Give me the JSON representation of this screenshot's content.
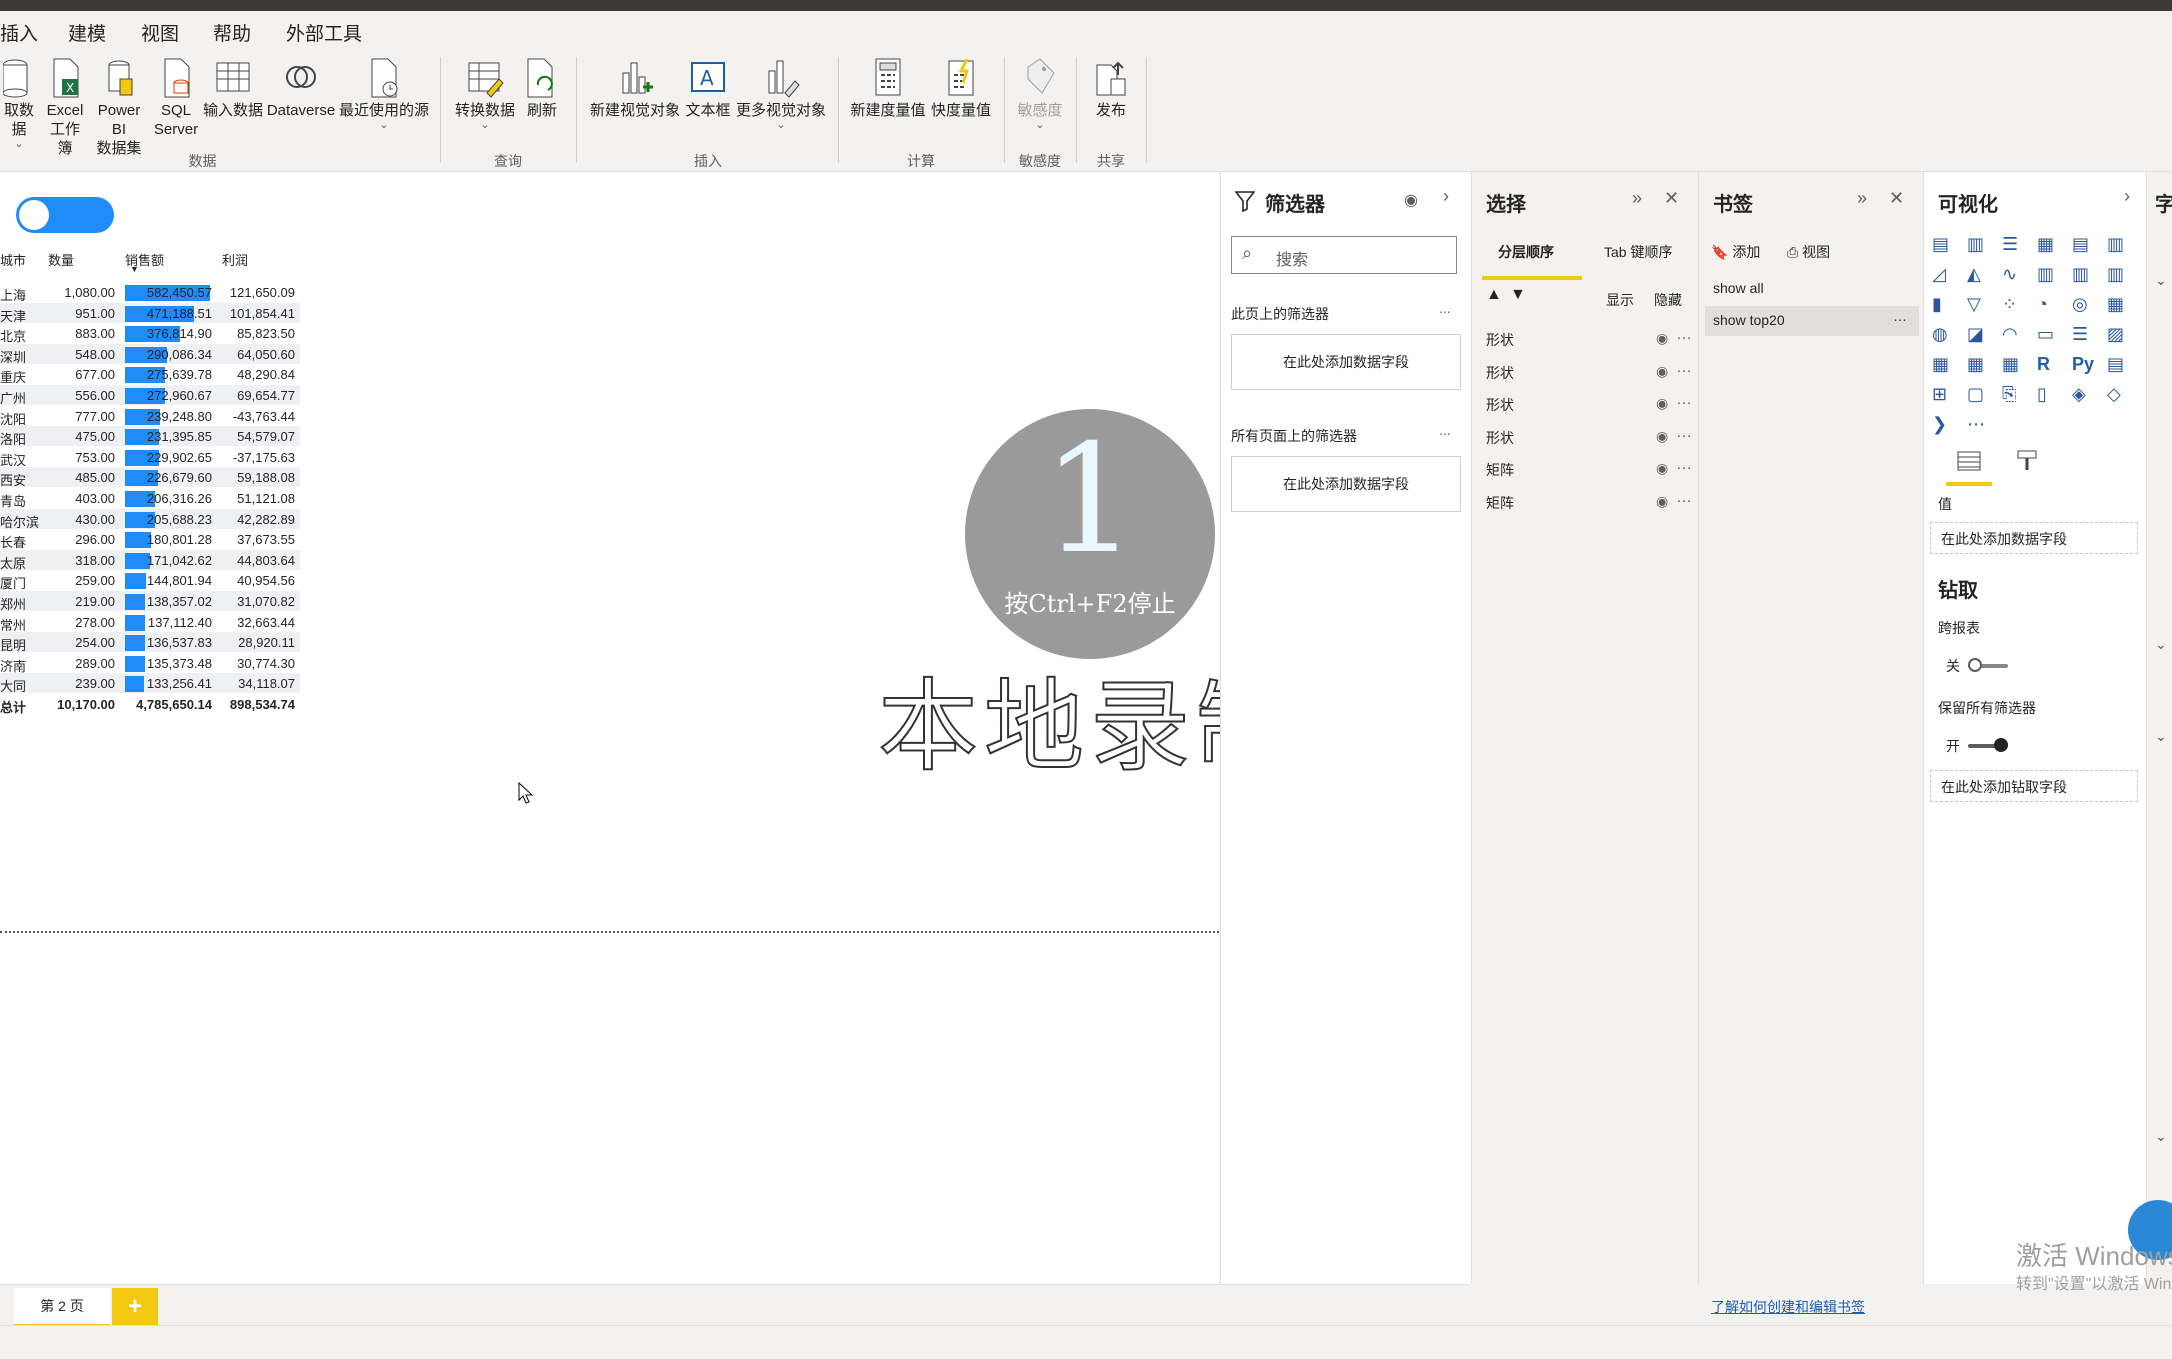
{
  "menu": [
    "插入",
    "建模",
    "视图",
    "帮助",
    "外部工具"
  ],
  "ribbon": {
    "buttons": {
      "get_data": "取数据",
      "excel": [
        "Excel",
        "工作簿"
      ],
      "powerbi": [
        "Power BI",
        "数据集"
      ],
      "sql": [
        "SQL",
        "Server"
      ],
      "enter_data": "输入数据",
      "dataverse": "Dataverse",
      "recent": "最近使用的源",
      "transform": "转换数据",
      "refresh": "刷新",
      "new_visual": "新建视觉对象",
      "textbox": "文本框",
      "more_visuals": "更多视觉对象",
      "new_measure": "新建度量值",
      "quick_measure": "快度量值",
      "sensitivity": "敏感度",
      "publish": "发布"
    },
    "groups": [
      "数据",
      "查询",
      "插入",
      "计算",
      "敏感度",
      "共享"
    ]
  },
  "matrix": {
    "headers": [
      "城市",
      "数量",
      "销售额",
      "利润"
    ],
    "rows": [
      {
        "city": "上海",
        "qty": "1,080.00",
        "sales": "582,450.57",
        "profit": "121,650.09",
        "v": 582450.57
      },
      {
        "city": "天津",
        "qty": "951.00",
        "sales": "471,188.51",
        "profit": "101,854.41",
        "v": 471188.51
      },
      {
        "city": "北京",
        "qty": "883.00",
        "sales": "376,814.90",
        "profit": "85,823.50",
        "v": 376814.9
      },
      {
        "city": "深圳",
        "qty": "548.00",
        "sales": "290,086.34",
        "profit": "64,050.60",
        "v": 290086.34
      },
      {
        "city": "重庆",
        "qty": "677.00",
        "sales": "275,639.78",
        "profit": "48,290.84",
        "v": 275639.78
      },
      {
        "city": "广州",
        "qty": "556.00",
        "sales": "272,960.67",
        "profit": "69,654.77",
        "v": 272960.67
      },
      {
        "city": "沈阳",
        "qty": "777.00",
        "sales": "239,248.80",
        "profit": "-43,763.44",
        "v": 239248.8
      },
      {
        "city": "洛阳",
        "qty": "475.00",
        "sales": "231,395.85",
        "profit": "54,579.07",
        "v": 231395.85
      },
      {
        "city": "武汉",
        "qty": "753.00",
        "sales": "229,902.65",
        "profit": "-37,175.63",
        "v": 229902.65
      },
      {
        "city": "西安",
        "qty": "485.00",
        "sales": "226,679.60",
        "profit": "59,188.08",
        "v": 226679.6
      },
      {
        "city": "青岛",
        "qty": "403.00",
        "sales": "206,316.26",
        "profit": "51,121.08",
        "v": 206316.26
      },
      {
        "city": "哈尔滨",
        "qty": "430.00",
        "sales": "205,688.23",
        "profit": "42,282.89",
        "v": 205688.23
      },
      {
        "city": "长春",
        "qty": "296.00",
        "sales": "180,801.28",
        "profit": "37,673.55",
        "v": 180801.28
      },
      {
        "city": "太原",
        "qty": "318.00",
        "sales": "171,042.62",
        "profit": "44,803.64",
        "v": 171042.62
      },
      {
        "city": "厦门",
        "qty": "259.00",
        "sales": "144,801.94",
        "profit": "40,954.56",
        "v": 144801.94
      },
      {
        "city": "郑州",
        "qty": "219.00",
        "sales": "138,357.02",
        "profit": "31,070.82",
        "v": 138357.02
      },
      {
        "city": "常州",
        "qty": "278.00",
        "sales": "137,112.40",
        "profit": "32,663.44",
        "v": 137112.4
      },
      {
        "city": "昆明",
        "qty": "254.00",
        "sales": "136,537.83",
        "profit": "28,920.11",
        "v": 136537.83
      },
      {
        "city": "济南",
        "qty": "289.00",
        "sales": "135,373.48",
        "profit": "30,774.30",
        "v": 135373.48
      },
      {
        "city": "大同",
        "qty": "239.00",
        "sales": "133,256.41",
        "profit": "34,118.07",
        "v": 133256.41
      }
    ],
    "total": {
      "city": "总计",
      "qty": "10,170.00",
      "sales": "4,785,650.14",
      "profit": "898,534.74"
    }
  },
  "overlay": {
    "number": "1",
    "stop_hint": "按Ctrl+F2停止",
    "recording": "本地录制"
  },
  "filters": {
    "title": "筛选器",
    "search_placeholder": "搜索",
    "this_page": "此页上的筛选器",
    "all_pages": "所有页面上的筛选器",
    "add_field": "在此处添加数据字段",
    "dots": "..."
  },
  "selection": {
    "title": "选择",
    "tab_layer": "分层顺序",
    "tab_tab": "Tab 键顺序",
    "show": "显示",
    "hide": "隐藏",
    "layers": [
      "形状",
      "形状",
      "形状",
      "形状",
      "矩阵",
      "矩阵"
    ]
  },
  "bookmarks": {
    "title": "书签",
    "add": "添加",
    "view": "视图",
    "items": [
      "show all",
      "show top20"
    ],
    "link": "了解如何创建和编辑书签"
  },
  "viz": {
    "title": "可视化",
    "values_label": "值",
    "add_field": "在此处添加数据字段",
    "drill_title": "钻取",
    "cross_report": "跨报表",
    "off": "关",
    "keep_filters": "保留所有筛选器",
    "on": "开",
    "add_drill": "在此处添加钻取字段"
  },
  "fields_edge": "字",
  "pages": {
    "tab": "第 2 页",
    "add": "+"
  },
  "watermark": {
    "line1": "激活 Windows",
    "line2": "转到\"设置\"以激活 Windows。"
  },
  "colors": {
    "accent": "#f2c811",
    "bar": "#1f8cfa"
  }
}
